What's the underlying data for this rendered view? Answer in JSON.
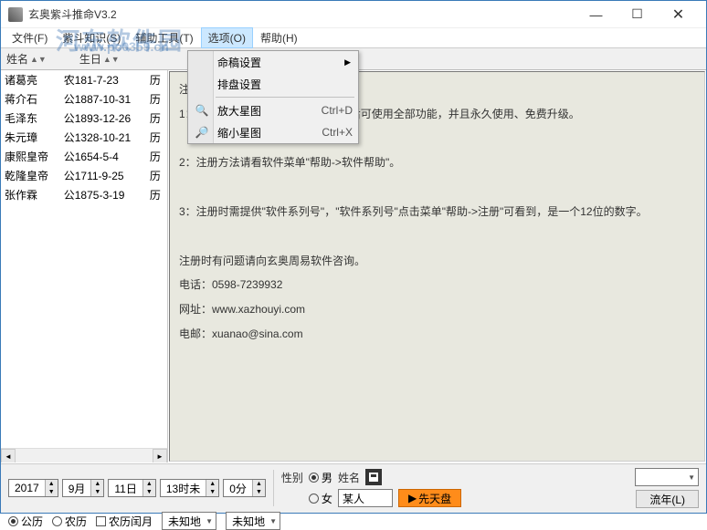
{
  "window": {
    "title": "玄奥紫斗推命V3.2",
    "controls": {
      "min": "—",
      "max": "☐",
      "close": "✕"
    }
  },
  "watermark": {
    "big": "河东软件园",
    "small": "www.pc0359.cn"
  },
  "menubar": {
    "items": [
      "文件(F)",
      "紫斗知识(S)",
      "辅助工具(T)",
      "选项(O)",
      "帮助(H)"
    ],
    "active_index": 3
  },
  "dropdown": {
    "items": [
      {
        "label": "命稿设置",
        "has_sub": true
      },
      {
        "label": "排盘设置"
      },
      {
        "sep": true
      },
      {
        "label": "放大星图",
        "shortcut": "Ctrl+D",
        "icon": "zoom-in"
      },
      {
        "label": "缩小星图",
        "shortcut": "Ctrl+X",
        "icon": "zoom-out"
      }
    ]
  },
  "list_header": {
    "name": "姓名",
    "birthday": "生日"
  },
  "people": [
    {
      "name": "诸葛亮",
      "cal": "农",
      "date": "181-7-23",
      "col4": "历"
    },
    {
      "name": "蒋介石",
      "cal": "公",
      "date": "1887-10-31",
      "col4": "历"
    },
    {
      "name": "毛泽东",
      "cal": "公",
      "date": "1893-12-26",
      "col4": "历"
    },
    {
      "name": "朱元璋",
      "cal": "公",
      "date": "1328-10-21",
      "col4": "历"
    },
    {
      "name": "康熙皇帝",
      "cal": "公",
      "date": "1654-5-4",
      "col4": "历"
    },
    {
      "name": "乾隆皇帝",
      "cal": "公",
      "date": "1711-9-25",
      "col4": "历"
    },
    {
      "name": "张作霖",
      "cal": "公",
      "date": "1875-3-19",
      "col4": "历"
    }
  ],
  "content": {
    "l0": "注册",
    "l1": "1：",
    "l1b": "命例，注册后可使用全部功能，并且永久使用、免费升级。",
    "l2": "2：注册方法请看软件菜单\"帮助->软件帮助\"。",
    "l3": "3：注册时需提供\"软件系列号\"，\"软件系列号\"点击菜单\"帮助->注册\"可看到，是一个12位的数字。",
    "l4": "注册时有问题请向玄奥周易软件咨询。",
    "l5": "电话：0598-7239932",
    "l6": "网址：www.xazhouyi.com",
    "l7": "电邮：xuanao@sina.com"
  },
  "bottom": {
    "year": "2017",
    "month": "9月",
    "day": "11日",
    "hour": "13时未",
    "minute": "0分",
    "province": "未知地",
    "city": "未知地",
    "sex_label": "性别",
    "male": "男",
    "female": "女",
    "name_label": "姓名",
    "name_value": "某人",
    "cal_solar": "公历",
    "cal_lunar": "农历",
    "cal_leap": "农历闰月",
    "btn_chart": "先天盘",
    "btn_year": "流年(L)"
  }
}
